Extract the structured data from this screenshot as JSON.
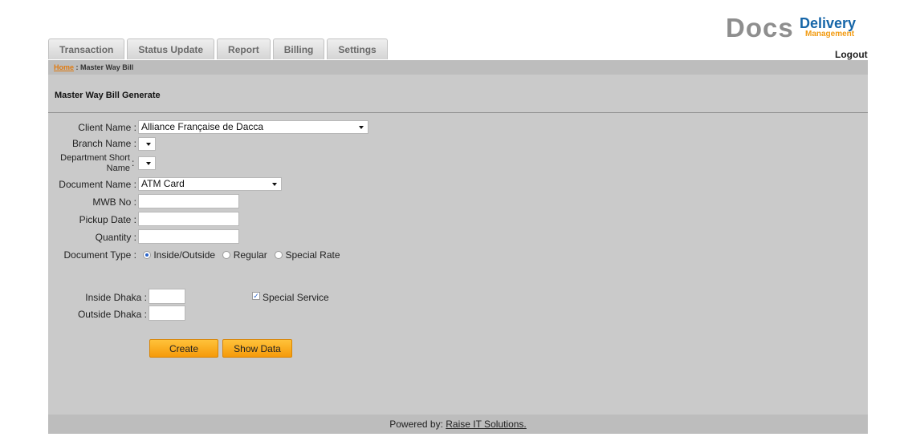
{
  "logo": {
    "word1": "Docs",
    "word2": "Delivery",
    "word3": "Management"
  },
  "tabs": [
    "Transaction",
    "Status Update",
    "Report",
    "Billing",
    "Settings"
  ],
  "logout_label": "Logout",
  "breadcrumb": {
    "home": "Home",
    "separator": " : ",
    "current": "Master Way Bill"
  },
  "page_title": "Master Way Bill Generate",
  "form": {
    "client_name_label": "Client Name :",
    "client_name_value": "Alliance Française de Dacca",
    "branch_name_label": "Branch Name :",
    "branch_name_value": "",
    "department_label_1": "Department Short",
    "department_label_2": "Name",
    "department_colon": ":",
    "department_value": "",
    "document_name_label": "Document Name :",
    "document_name_value": "ATM Card",
    "mwb_no_label": "MWB No :",
    "mwb_no_value": "",
    "pickup_date_label": "Pickup Date :",
    "pickup_date_value": "",
    "quantity_label": "Quantity :",
    "quantity_value": "",
    "document_type_label": "Document Type :",
    "document_type_options": [
      "Inside/Outside",
      "Regular",
      "Special Rate"
    ],
    "document_type_selected": "Inside/Outside",
    "inside_dhaka_label": "Inside Dhaka :",
    "inside_dhaka_value": "",
    "outside_dhaka_label": "Outside Dhaka :",
    "outside_dhaka_value": "",
    "special_service_label": "Special Service",
    "special_service_checked": true
  },
  "buttons": {
    "create": "Create",
    "show_data": "Show Data"
  },
  "footer": {
    "prefix": "Powered by: ",
    "link": "Raise IT Solutions."
  },
  "colors": {
    "accent_orange": "#f59a0a",
    "panel_gray": "#cacaca",
    "brand_blue": "#1565a8"
  }
}
